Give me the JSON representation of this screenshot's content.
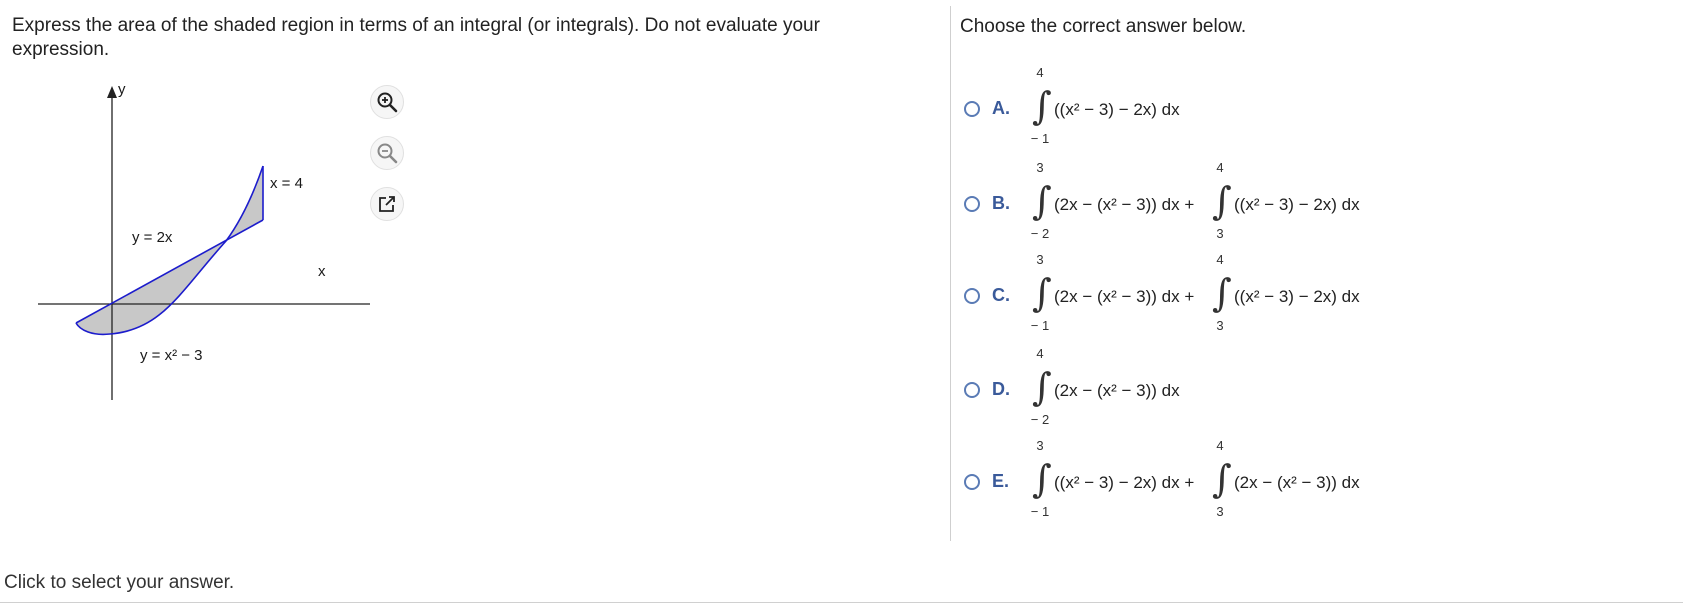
{
  "question": {
    "text": "Express the area of the shaded region in terms of an integral (or integrals). Do not evaluate your expression."
  },
  "graph": {
    "y_axis_label": "y",
    "x_axis_label": "x",
    "line_label": "y = 2x",
    "parabola_label": "y = x² − 3",
    "vertical_label": "x = 4",
    "shade_color": "#c8c8c8",
    "curve_color": "#1c1ccc"
  },
  "tools": {
    "zoom_in": "zoom-in-icon",
    "zoom_out": "zoom-out-icon",
    "popout": "popout-icon"
  },
  "prompt": "Choose the correct answer below.",
  "options": [
    {
      "letter": "A.",
      "parts": [
        {
          "upper": "4",
          "lower": "− 1",
          "integrand": "((x² − 3) − 2x) dx"
        }
      ]
    },
    {
      "letter": "B.",
      "parts": [
        {
          "upper": "3",
          "lower": "− 2",
          "integrand": "(2x − (x² − 3)) dx +"
        },
        {
          "upper": "4",
          "lower": "3",
          "integrand": "((x² − 3) − 2x) dx"
        }
      ]
    },
    {
      "letter": "C.",
      "parts": [
        {
          "upper": "3",
          "lower": "− 1",
          "integrand": "(2x − (x² − 3)) dx +"
        },
        {
          "upper": "4",
          "lower": "3",
          "integrand": "((x² − 3) − 2x) dx"
        }
      ]
    },
    {
      "letter": "D.",
      "parts": [
        {
          "upper": "4",
          "lower": "− 2",
          "integrand": "(2x − (x² − 3)) dx"
        }
      ]
    },
    {
      "letter": "E.",
      "parts": [
        {
          "upper": "3",
          "lower": "− 1",
          "integrand": "((x² − 3) − 2x) dx +"
        },
        {
          "upper": "4",
          "lower": "3",
          "integrand": "(2x − (x² − 3)) dx"
        }
      ]
    }
  ],
  "status": "Click to select your answer."
}
